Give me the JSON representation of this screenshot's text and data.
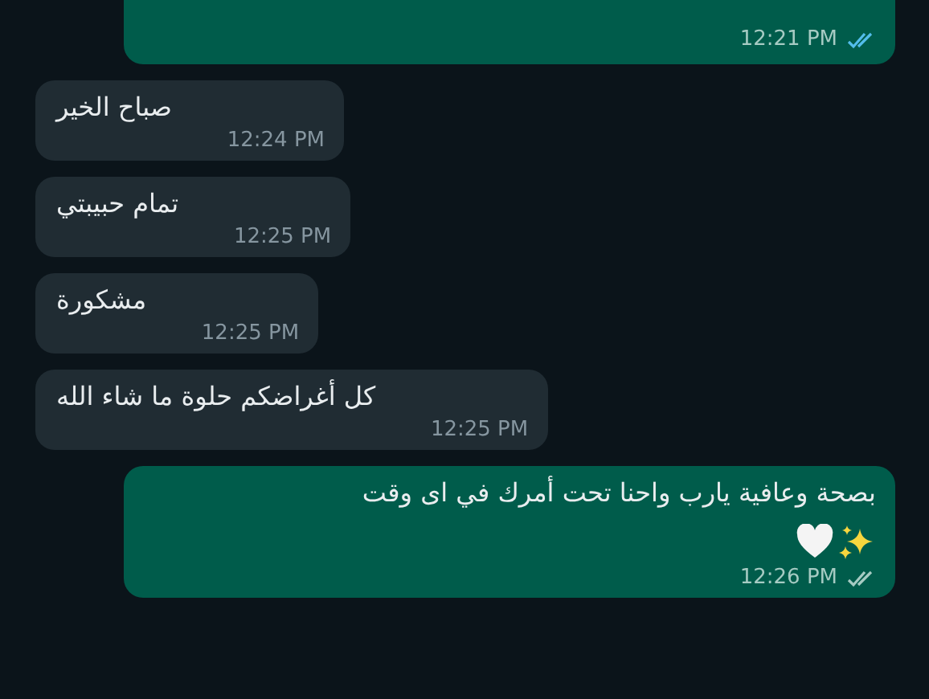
{
  "messages": [
    {
      "kind": "outgoing",
      "cut": true,
      "time": "12:21 PM",
      "read": true
    },
    {
      "kind": "incoming",
      "text": "صباح الخير",
      "time": "12:24 PM"
    },
    {
      "kind": "incoming",
      "text": "تمام حبيبتي",
      "time": "12:25 PM"
    },
    {
      "kind": "incoming",
      "text": "مشكورة",
      "time": "12:25 PM"
    },
    {
      "kind": "incoming",
      "text": "كل أغراضكم حلوة ما شاء الله",
      "time": "12:25 PM"
    },
    {
      "kind": "outgoing",
      "text": "بصحة وعافية يارب واحنا تحت أمرك في اى وقت",
      "has_emojis": true,
      "time": "12:26 PM",
      "read": false
    }
  ]
}
